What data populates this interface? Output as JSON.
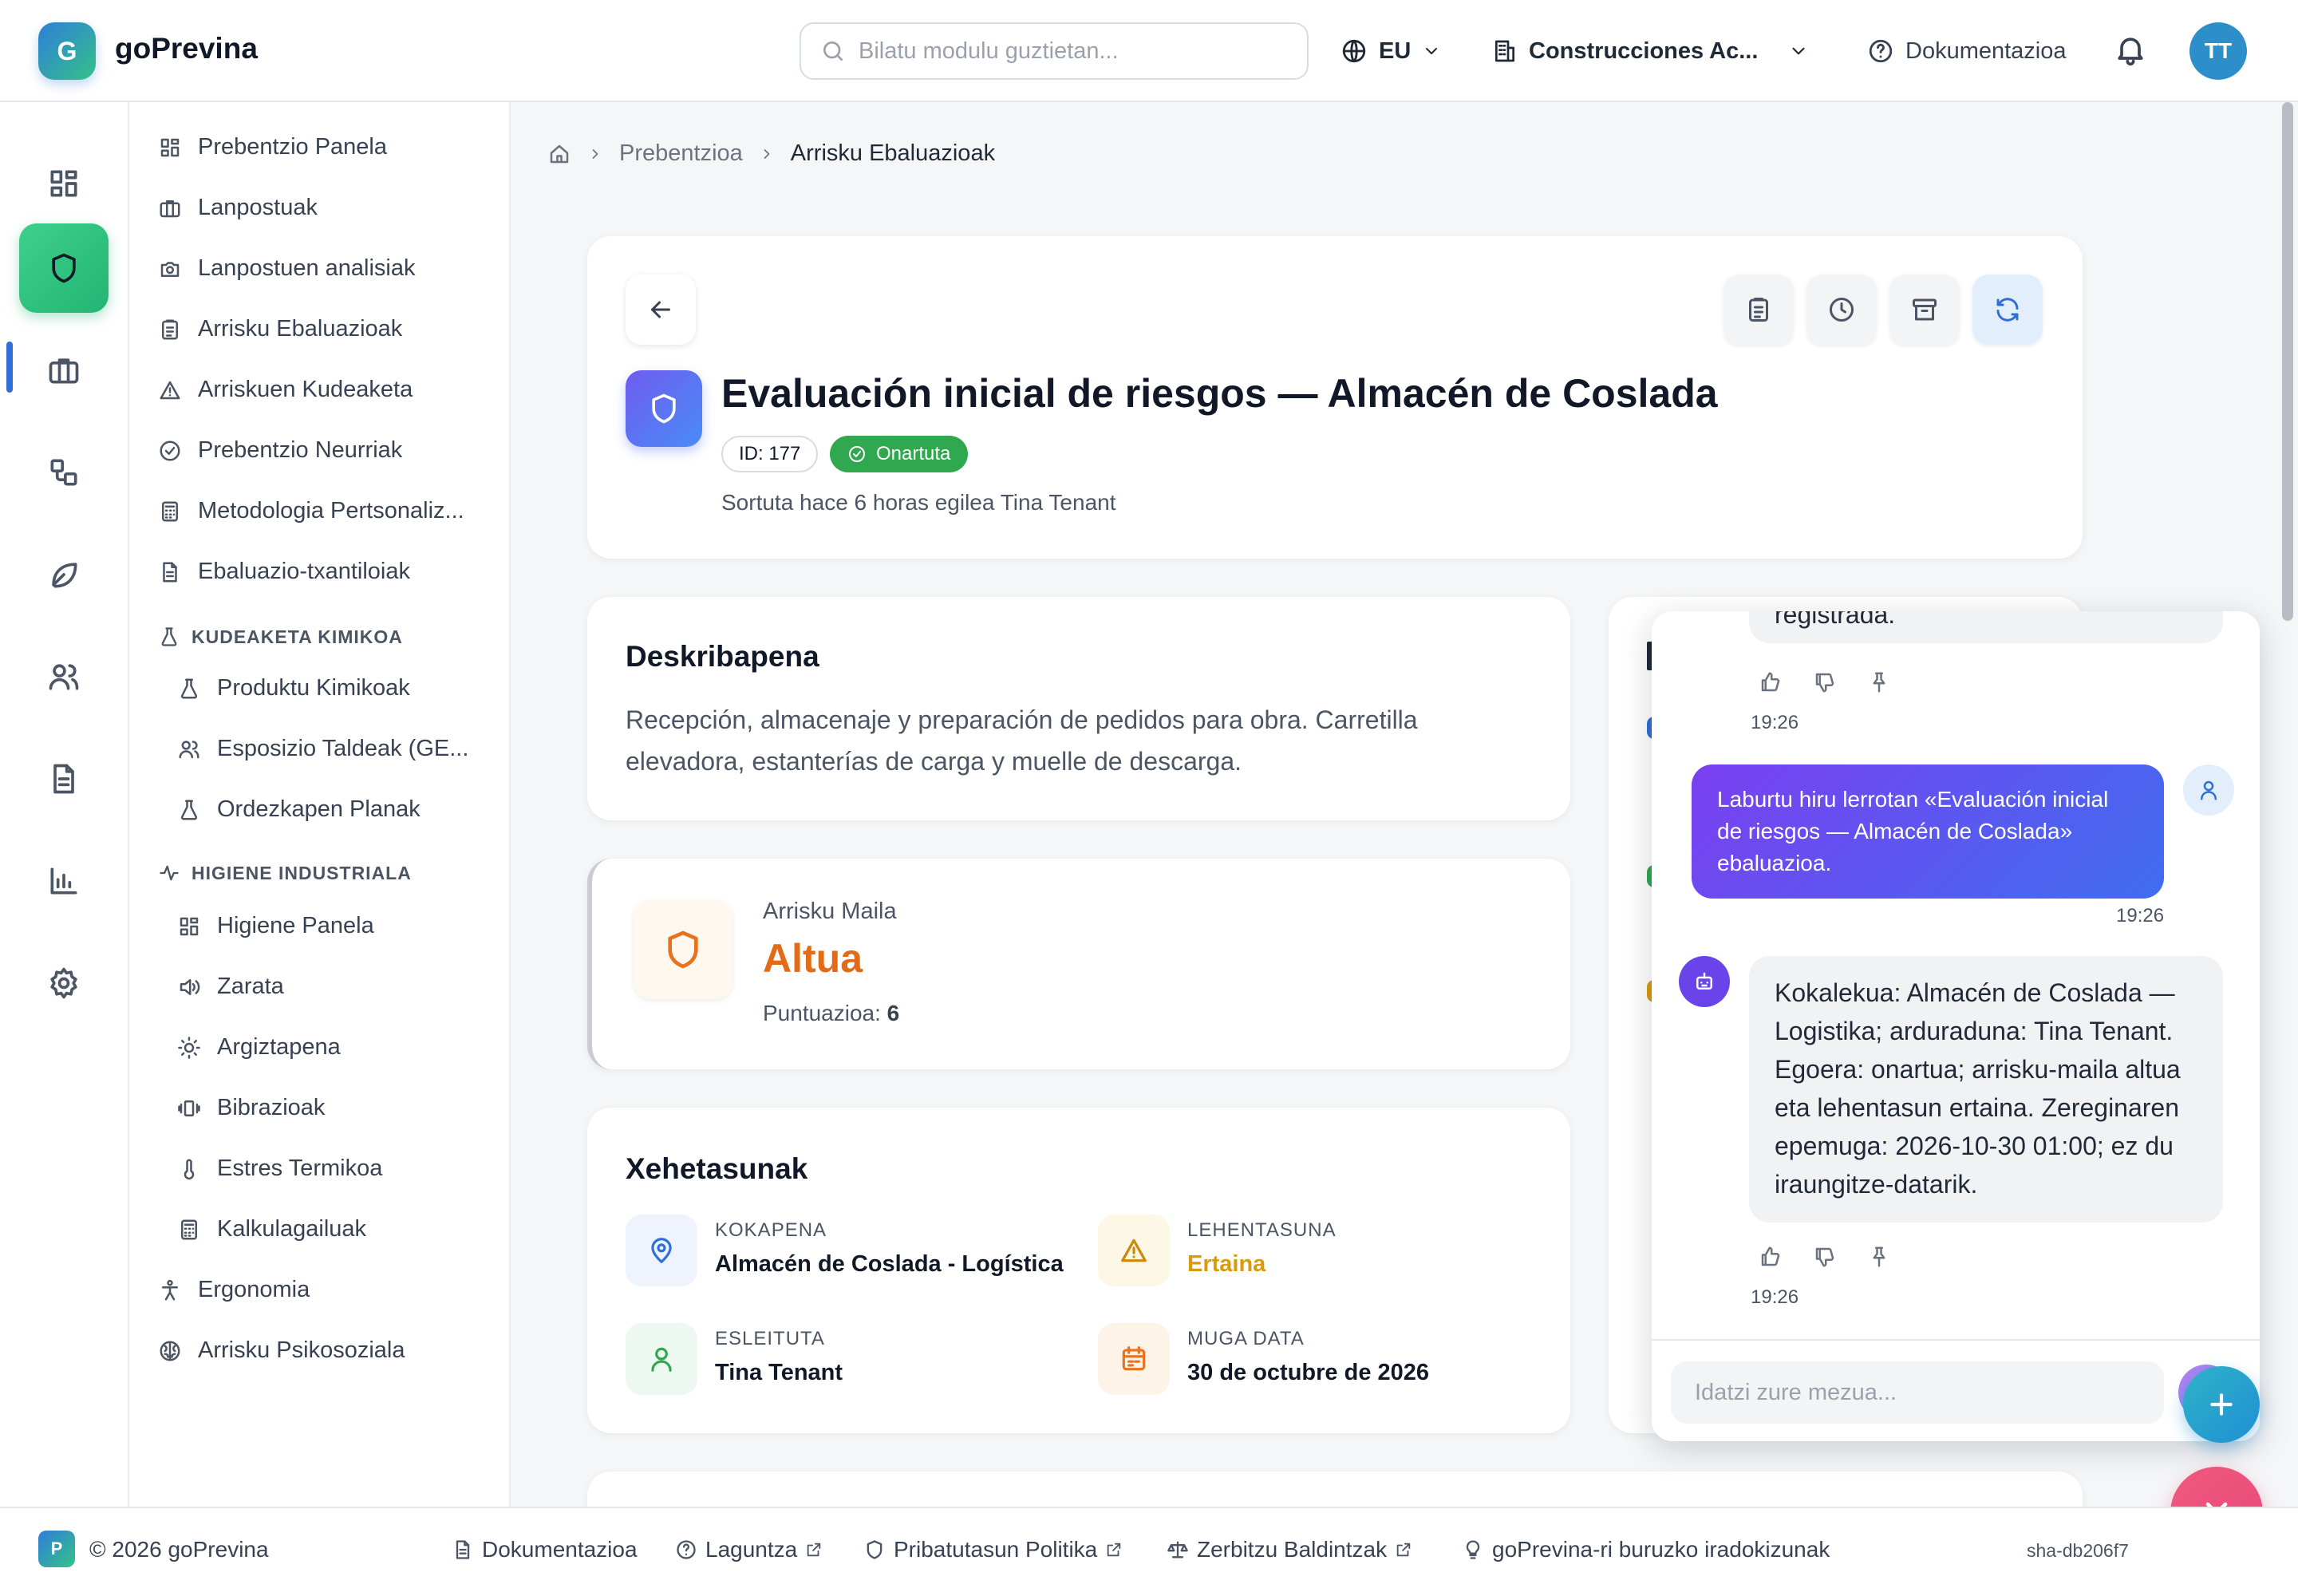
{
  "app": {
    "logo_letter": "G",
    "brand": "goPrevina"
  },
  "topbar": {
    "search_placeholder": "Bilatu modulu guztietan...",
    "language": "EU",
    "company": "Construcciones Ac...",
    "docs": "Dokumentazioa",
    "avatar_initials": "TT"
  },
  "rail": {
    "items": [
      "dashboard-icon",
      "shield-icon",
      "briefcase-icon",
      "workflow-icon",
      "leaf-icon",
      "users-icon",
      "document-icon",
      "bar-chart-icon",
      "settings-icon"
    ],
    "active": "shield-icon"
  },
  "submenu": {
    "items": [
      "Prebentzio Panela",
      "Lanpostuak",
      "Lanpostuen analisiak",
      "Arrisku Ebaluazioak",
      "Arriskuen Kudeaketa",
      "Prebentzio Neurriak",
      "Metodologia Pertsonaliz...",
      "Ebaluazio-txantiloiak"
    ],
    "chem_header": "KUDEAKETA KIMIKOA",
    "chem_items": [
      "Produktu Kimikoak",
      "Esposizio Taldeak (GE...",
      "Ordezkapen Planak"
    ],
    "hygiene_header": "HIGIENE INDUSTRIALA",
    "hygiene_items": [
      "Higiene Panela",
      "Zarata",
      "Argiztapena",
      "Bibrazioak",
      "Estres Termikoa",
      "Kalkulagailuak"
    ],
    "bottom_items": [
      "Ergonomia",
      "Arrisku Psikosoziala"
    ]
  },
  "breadcrumb": {
    "level1": "Prebentzioa",
    "current": "Arrisku Ebaluazioak"
  },
  "header": {
    "title": "Evaluación inicial de riesgos — Almacén de Coslada",
    "id": "ID: 177",
    "status": "Onartuta",
    "created": "Sortuta hace 6 horas egilea Tina Tenant"
  },
  "description": {
    "title": "Deskribapena",
    "text": "Recepción, almacenaje y preparación de pedidos para obra. Carretilla elevadora, estanterías de carga y muelle de descarga."
  },
  "risk": {
    "label": "Arrisku Maila",
    "value": "Altua",
    "score_label": "Puntuazioa:",
    "score": "6"
  },
  "details": {
    "title": "Xehetasunak",
    "location_label": "KOKAPENA",
    "location": "Almacén de Coslada - Logística",
    "priority_label": "LEHENTASUNA",
    "priority": "Ertaina",
    "assignee_label": "ESLEITUTA",
    "assignee": "Tina Tenant",
    "due_label": "MUGA DATA",
    "due": "30 de octubre de 2026"
  },
  "chat": {
    "prev_bot_tail": "registrada.",
    "prev_time": "19:26",
    "user_msg": "Laburtu hiru lerrotan «Evaluación inicial de riesgos — Almacén de Coslada» ebaluazioa.",
    "user_time": "19:26",
    "bot_msg": "Kokalekua: Almacén de Coslada — Logistika; arduraduna: Tina Tenant. Egoera: onartua; arrisku-maila altua eta lehentasun ertaina. Zereginaren epemuga: 2026-10-30 01:00; ez du iraungitze-datarik.",
    "bot_time": "19:26",
    "input_placeholder": "Idatzi zure mezua..."
  },
  "footer": {
    "logo_letter": "P",
    "copyright": "© 2026 goPrevina",
    "docs": "Dokumentazioa",
    "help": "Laguntza",
    "privacy": "Pribatutasun Politika",
    "terms": "Zerbitzu Baldintzak",
    "ideas": "goPrevina-ri buruzko iradokizunak",
    "sha": "sha-db206f7"
  },
  "colors": {
    "accent_green": "#22b573",
    "accent_blue": "#2f6fd6",
    "risk_orange": "#e36a16",
    "priority_amber": "#d99a0b",
    "status_green": "#2fa84f"
  }
}
